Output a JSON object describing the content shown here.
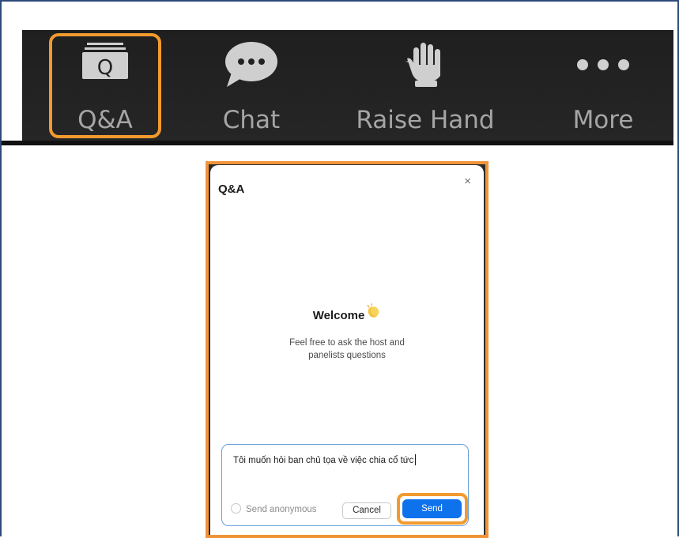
{
  "toolbar": {
    "items": [
      {
        "label": "Q&A",
        "icon": "qa-icon"
      },
      {
        "label": "Chat",
        "icon": "chat-bubble-icon"
      },
      {
        "label": "Raise Hand",
        "icon": "raise-hand-icon"
      },
      {
        "label": "More",
        "icon": "more-dots-icon"
      }
    ],
    "highlight_color": "#f39a2f"
  },
  "dialog": {
    "title": "Q&A",
    "close_label": "×",
    "welcome": "Welcome",
    "subtitle_line1": "Feel free to ask the host and",
    "subtitle_line2": "panelists questions",
    "input_value": "Tôi muốn hỏi ban chủ tọa về việc chia cổ tức",
    "anonymous_label": "Send anonymous",
    "cancel_label": "Cancel",
    "send_label": "Send",
    "send_color": "#0e72ed"
  }
}
